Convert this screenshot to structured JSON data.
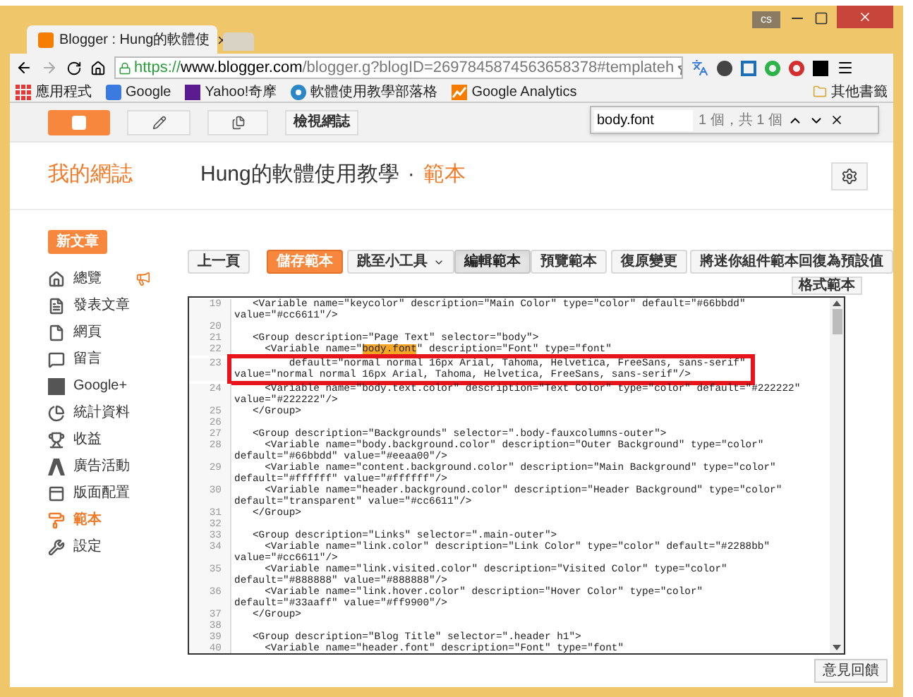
{
  "browser": {
    "tab_title": "Blogger : Hung的軟體使",
    "user_badge": "cs",
    "url_scheme": "https://",
    "url_host": "www.blogger.com",
    "url_path": "/blogger.g?blogID=2697845874563658378#templateh",
    "bookmarks": [
      {
        "kind": "apps",
        "label": "應用程式"
      },
      {
        "kind": "google",
        "label": "Google"
      },
      {
        "kind": "yahoo",
        "label": "Yahoo!奇摩"
      },
      {
        "kind": "blog",
        "label": "軟體使用教學部落格"
      },
      {
        "kind": "analytics",
        "label": "Google Analytics"
      }
    ],
    "other_bookmarks": "其他書籤"
  },
  "find_bar": {
    "query": "body.font",
    "count": "1 個，共 1 個"
  },
  "top_bar": {
    "view_blog": "檢視網誌"
  },
  "header": {
    "my_blogs": "我的網誌",
    "blog_title": "Hung的軟體使用教學",
    "separator": "·",
    "page": "範本"
  },
  "sidebar": {
    "new_post": "新文章",
    "items": [
      {
        "kind": "overview",
        "label": "總覽",
        "selected": false
      },
      {
        "kind": "posts",
        "label": "發表文章",
        "selected": false
      },
      {
        "kind": "pages",
        "label": "網頁",
        "selected": false
      },
      {
        "kind": "comments",
        "label": "留言",
        "selected": false
      },
      {
        "kind": "gplus",
        "label": "Google+",
        "selected": false
      },
      {
        "kind": "stats",
        "label": "統計資料",
        "selected": false
      },
      {
        "kind": "earnings",
        "label": "收益",
        "selected": false
      },
      {
        "kind": "ads",
        "label": "廣告活動",
        "selected": false
      },
      {
        "kind": "layout",
        "label": "版面配置",
        "selected": false
      },
      {
        "kind": "template",
        "label": "範本",
        "selected": true
      },
      {
        "kind": "settings",
        "label": "設定",
        "selected": false
      }
    ]
  },
  "toolbar": {
    "buttons": [
      {
        "kind": "plain",
        "label": "上一頁"
      },
      {
        "kind": "primary",
        "label": "儲存範本"
      },
      {
        "kind": "dropdown",
        "label": "跳至小工具"
      },
      {
        "kind": "segment",
        "label": "編輯範本",
        "selected": true
      },
      {
        "kind": "segment",
        "label": "預覽範本",
        "selected": false
      },
      {
        "kind": "plain",
        "label": "復原變更"
      },
      {
        "kind": "plain",
        "label": "將迷你組件範本回復為預設值"
      }
    ],
    "format_button": "格式範本"
  },
  "editor": {
    "lines": [
      {
        "number": "19",
        "boxed": false,
        "rows": [
          "   <Variable name=\"keycolor\" description=\"Main Color\" type=\"color\" default=\"#66bbdd\"",
          "value=\"#cc6611\"/>"
        ]
      },
      {
        "number": "20",
        "boxed": false
      },
      {
        "number": "21",
        "boxed": false,
        "rows": [
          "   <Group description=\"Page Text\" selector=\"body\">"
        ]
      },
      {
        "number": "22",
        "boxed": false,
        "rows": [
          {
            "before": "     <Variable name=\"",
            "match": "body.font",
            "after": "\" description=\"Font\" type=\"font\""
          }
        ]
      },
      {
        "number": "23",
        "boxed": true,
        "rows": [
          "         default=\"normal normal 16px Arial, Tahoma, Helvetica, FreeSans, sans-serif\"",
          "value=\"normal normal 16px Arial, Tahoma, Helvetica, FreeSans, sans-serif\"/>"
        ]
      },
      {
        "number": "24",
        "boxed": false,
        "rows": [
          "     <Variable name=\"body.text.color\" description=\"Text Color\" type=\"color\" default=\"#222222\"",
          "value=\"#222222\"/>"
        ]
      },
      {
        "number": "25",
        "boxed": false,
        "rows": [
          "   </Group>"
        ]
      },
      {
        "number": "26",
        "boxed": false
      },
      {
        "number": "27",
        "boxed": false,
        "rows": [
          "   <Group description=\"Backgrounds\" selector=\".body-fauxcolumns-outer\">"
        ]
      },
      {
        "number": "28",
        "boxed": false,
        "rows": [
          "     <Variable name=\"body.background.color\" description=\"Outer Background\" type=\"color\"",
          "default=\"#66bbdd\" value=\"#eeaa00\"/>"
        ]
      },
      {
        "number": "29",
        "boxed": false,
        "rows": [
          "     <Variable name=\"content.background.color\" description=\"Main Background\" type=\"color\"",
          "default=\"#ffffff\" value=\"#ffffff\"/>"
        ]
      },
      {
        "number": "30",
        "boxed": false,
        "rows": [
          "     <Variable name=\"header.background.color\" description=\"Header Background\" type=\"color\"",
          "default=\"transparent\" value=\"#cc6611\"/>"
        ]
      },
      {
        "number": "31",
        "boxed": false,
        "rows": [
          "   </Group>"
        ]
      },
      {
        "number": "32",
        "boxed": false
      },
      {
        "number": "33",
        "boxed": false,
        "rows": [
          "   <Group description=\"Links\" selector=\".main-outer\">"
        ]
      },
      {
        "number": "34",
        "boxed": false,
        "rows": [
          "     <Variable name=\"link.color\" description=\"Link Color\" type=\"color\" default=\"#2288bb\"",
          "value=\"#cc6611\"/>"
        ]
      },
      {
        "number": "35",
        "boxed": false,
        "rows": [
          "     <Variable name=\"link.visited.color\" description=\"Visited Color\" type=\"color\"",
          "default=\"#888888\" value=\"#888888\"/>"
        ]
      },
      {
        "number": "36",
        "boxed": false,
        "rows": [
          "     <Variable name=\"link.hover.color\" description=\"Hover Color\" type=\"color\"",
          "default=\"#33aaff\" value=\"#ff9900\"/>"
        ]
      },
      {
        "number": "37",
        "boxed": false,
        "rows": [
          "   </Group>"
        ]
      },
      {
        "number": "38",
        "boxed": false
      },
      {
        "number": "39",
        "boxed": false,
        "rows": [
          "   <Group description=\"Blog Title\" selector=\".header h1\">"
        ]
      },
      {
        "number": "40",
        "boxed": false,
        "rows": [
          "     <Variable name=\"header.font\" description=\"Font\" type=\"font\""
        ]
      }
    ]
  },
  "feedback": "意見回饋"
}
